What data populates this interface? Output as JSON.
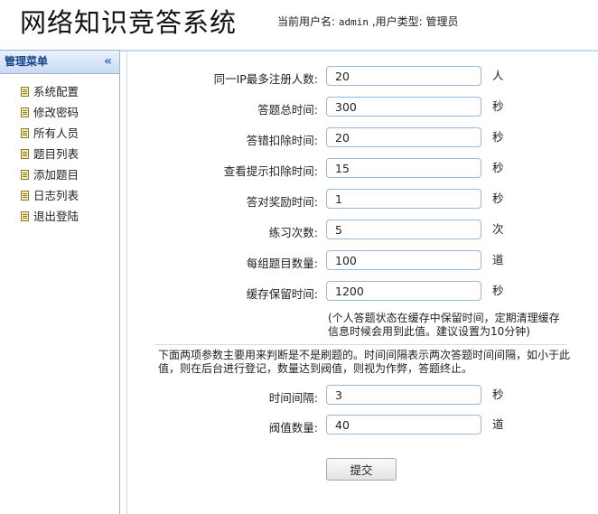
{
  "header": {
    "title": "网络知识竞答系统",
    "user_label": "当前用户名:",
    "username": "admin",
    "type_label": ",用户类型:",
    "user_type": "管理员"
  },
  "sidebar": {
    "title": "管理菜单",
    "collapse_glyph": "«",
    "items": [
      {
        "label": "系统配置"
      },
      {
        "label": "修改密码"
      },
      {
        "label": "所有人员"
      },
      {
        "label": "题目列表"
      },
      {
        "label": "添加题目"
      },
      {
        "label": "日志列表"
      },
      {
        "label": "退出登陆"
      }
    ]
  },
  "form": {
    "fields": [
      {
        "label": "同一IP最多注册人数:",
        "value": "20",
        "unit": "人"
      },
      {
        "label": "答题总时间:",
        "value": "300",
        "unit": "秒"
      },
      {
        "label": "答错扣除时间:",
        "value": "20",
        "unit": "秒"
      },
      {
        "label": "查看提示扣除时间:",
        "value": "15",
        "unit": "秒"
      },
      {
        "label": "答对奖励时间:",
        "value": "1",
        "unit": "秒"
      },
      {
        "label": "练习次数:",
        "value": "5",
        "unit": "次"
      },
      {
        "label": "每组题目数量:",
        "value": "100",
        "unit": "道"
      },
      {
        "label": "缓存保留时间:",
        "value": "1200",
        "unit": "秒"
      }
    ],
    "cache_note": "(个人答题状态在缓存中保留时间，定期清理缓存信息时候会用到此值。建议设置为10分钟)",
    "rate_note": "下面两项参数主要用来判断是不是刷题的。时间间隔表示两次答题时间间隔，如小于此值，则在后台进行登记，数量达到阀值，则视为作弊，答题终止。",
    "rate_fields": [
      {
        "label": "时间间隔:",
        "value": "3",
        "unit": "秒"
      },
      {
        "label": "阀值数量:",
        "value": "40",
        "unit": "道"
      }
    ],
    "submit_label": "提交"
  }
}
